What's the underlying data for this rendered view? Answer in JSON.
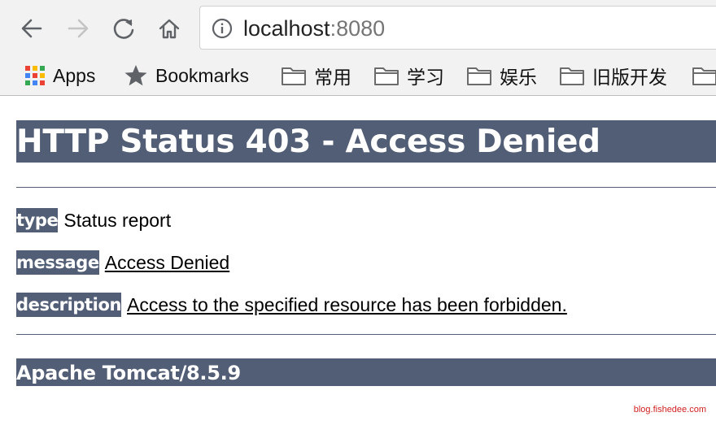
{
  "browser": {
    "url_host": "localhost",
    "url_port": ":8080",
    "icons": [
      "back-icon",
      "forward-icon",
      "reload-icon",
      "home-icon",
      "info-icon"
    ]
  },
  "bookmarks_bar": {
    "items": [
      {
        "label": "Apps",
        "icon": "apps-grid-icon"
      },
      {
        "label": "Bookmarks",
        "icon": "star-icon"
      },
      {
        "label": "常用",
        "icon": "folder-icon"
      },
      {
        "label": "学习",
        "icon": "folder-icon"
      },
      {
        "label": "娱乐",
        "icon": "folder-icon"
      },
      {
        "label": "旧版开发",
        "icon": "folder-icon"
      }
    ]
  },
  "page": {
    "title": "HTTP Status 403 - Access Denied",
    "type_label": "type",
    "type_value": "Status report",
    "message_label": "message",
    "message_value": "Access Denied",
    "description_label": "description",
    "description_value": "Access to the specified resource has been forbidden.",
    "footer": "Apache Tomcat/8.5.9"
  },
  "watermark": "blog.fishedee.com",
  "colors": {
    "tomcat_header": "#525d76",
    "chrome_bar": "#f2f2f2",
    "watermark": "#d02020"
  }
}
